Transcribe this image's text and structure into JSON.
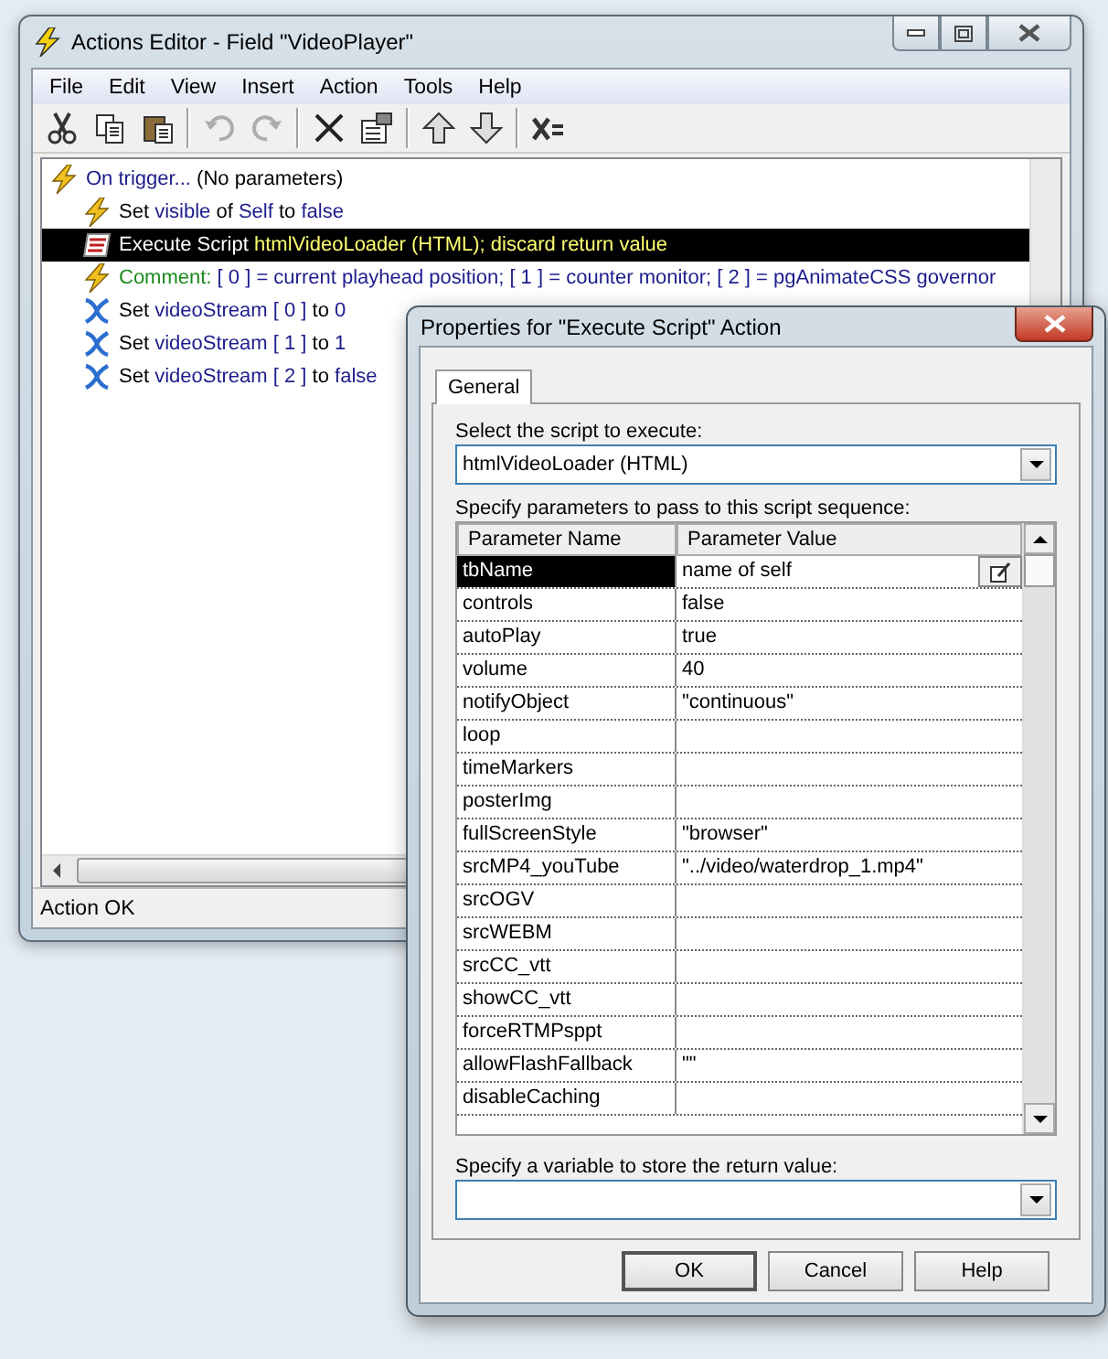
{
  "window": {
    "title": "Actions Editor - Field \"VideoPlayer\""
  },
  "menu": [
    "File",
    "Edit",
    "View",
    "Insert",
    "Action",
    "Tools",
    "Help"
  ],
  "toolbar": [
    [
      {
        "kind": "cut",
        "disabled": false
      },
      {
        "kind": "copy",
        "disabled": false
      },
      {
        "kind": "paste",
        "disabled": false
      }
    ],
    [
      {
        "kind": "undo",
        "disabled": true
      },
      {
        "kind": "redo",
        "disabled": true
      }
    ],
    [
      {
        "kind": "delete",
        "disabled": false
      },
      {
        "kind": "properties",
        "disabled": false
      }
    ],
    [
      {
        "kind": "up",
        "disabled": false
      },
      {
        "kind": "down",
        "disabled": false
      }
    ],
    [
      {
        "kind": "variable",
        "disabled": false
      }
    ]
  ],
  "actions": [
    {
      "kind": "trigger",
      "selected": false,
      "segments": [
        {
          "kind": "ref",
          "text": "On trigger..."
        },
        {
          "kind": "plain",
          "text": " (No parameters)"
        }
      ],
      "children": [
        {
          "kind": "trigger",
          "selected": false,
          "segments": [
            {
              "kind": "plain",
              "text": "Set "
            },
            {
              "kind": "ref",
              "text": "visible"
            },
            {
              "kind": "plain",
              "text": " of "
            },
            {
              "kind": "ref",
              "text": "Self"
            },
            {
              "kind": "plain",
              "text": " to "
            },
            {
              "kind": "ref",
              "text": "false"
            }
          ]
        },
        {
          "kind": "script",
          "selected": true,
          "segments": [
            {
              "kind": "plain",
              "text": "Execute Script "
            },
            {
              "kind": "ref",
              "text": "htmlVideoLoader (HTML); discard return value"
            }
          ]
        },
        {
          "kind": "trigger",
          "selected": false,
          "segments": [
            {
              "kind": "comment",
              "text": "Comment: "
            },
            {
              "kind": "ref",
              "text": "[ 0 ] = current playhead position; [ 1 ] = counter monitor; [ 2 ] = pgAnimateCSS governor"
            }
          ]
        },
        {
          "kind": "variable",
          "selected": false,
          "segments": [
            {
              "kind": "plain",
              "text": "Set "
            },
            {
              "kind": "ref",
              "text": "videoStream [ 0 ]"
            },
            {
              "kind": "plain",
              "text": " to "
            },
            {
              "kind": "ref",
              "text": "0"
            }
          ]
        },
        {
          "kind": "variable",
          "selected": false,
          "segments": [
            {
              "kind": "plain",
              "text": "Set "
            },
            {
              "kind": "ref",
              "text": "videoStream [ 1 ]"
            },
            {
              "kind": "plain",
              "text": " to "
            },
            {
              "kind": "ref",
              "text": "1"
            }
          ]
        },
        {
          "kind": "variable",
          "selected": false,
          "segments": [
            {
              "kind": "plain",
              "text": "Set "
            },
            {
              "kind": "ref",
              "text": "videoStream [ 2 ]"
            },
            {
              "kind": "plain",
              "text": " to "
            },
            {
              "kind": "ref",
              "text": "false"
            }
          ]
        }
      ]
    }
  ],
  "status_bar": "Action OK",
  "dialog": {
    "title": "Properties for \"Execute Script\" Action",
    "tabs": [
      {
        "label": "General",
        "selected": true
      }
    ],
    "script_label": "Select the script to execute:",
    "script_value": "htmlVideoLoader (HTML)",
    "params_label": "Specify parameters to pass to this script sequence:",
    "params": {
      "columns": [
        "Parameter Name",
        "Parameter Value"
      ],
      "rows": [
        {
          "name": "tbName",
          "value": "name of self",
          "selected": true
        },
        {
          "name": "controls",
          "value": "false",
          "selected": false
        },
        {
          "name": "autoPlay",
          "value": "true",
          "selected": false
        },
        {
          "name": "volume",
          "value": "40",
          "selected": false
        },
        {
          "name": "notifyObject",
          "value": "\"continuous\"",
          "selected": false
        },
        {
          "name": "loop",
          "selected": false
        },
        {
          "name": "timeMarkers",
          "selected": false
        },
        {
          "name": "posterImg",
          "selected": false
        },
        {
          "name": "fullScreenStyle",
          "value": "\"browser\"",
          "selected": false
        },
        {
          "name": "srcMP4_youTube",
          "value": "\"../video/waterdrop_1.mp4\"",
          "selected": false
        },
        {
          "name": "srcOGV",
          "selected": false
        },
        {
          "name": "srcWEBM",
          "selected": false
        },
        {
          "name": "srcCC_vtt",
          "selected": false
        },
        {
          "name": "showCC_vtt",
          "selected": false
        },
        {
          "name": "forceRTMPsppt",
          "selected": false
        },
        {
          "name": "allowFlashFallback",
          "value": "\"\"",
          "selected": false
        },
        {
          "name": "disableCaching",
          "selected": false
        }
      ]
    },
    "return_label": "Specify a variable to store the return value:",
    "buttons": [
      {
        "label": "OK",
        "default": true
      },
      {
        "label": "Cancel",
        "default": false
      },
      {
        "label": "Help",
        "default": false
      }
    ]
  }
}
